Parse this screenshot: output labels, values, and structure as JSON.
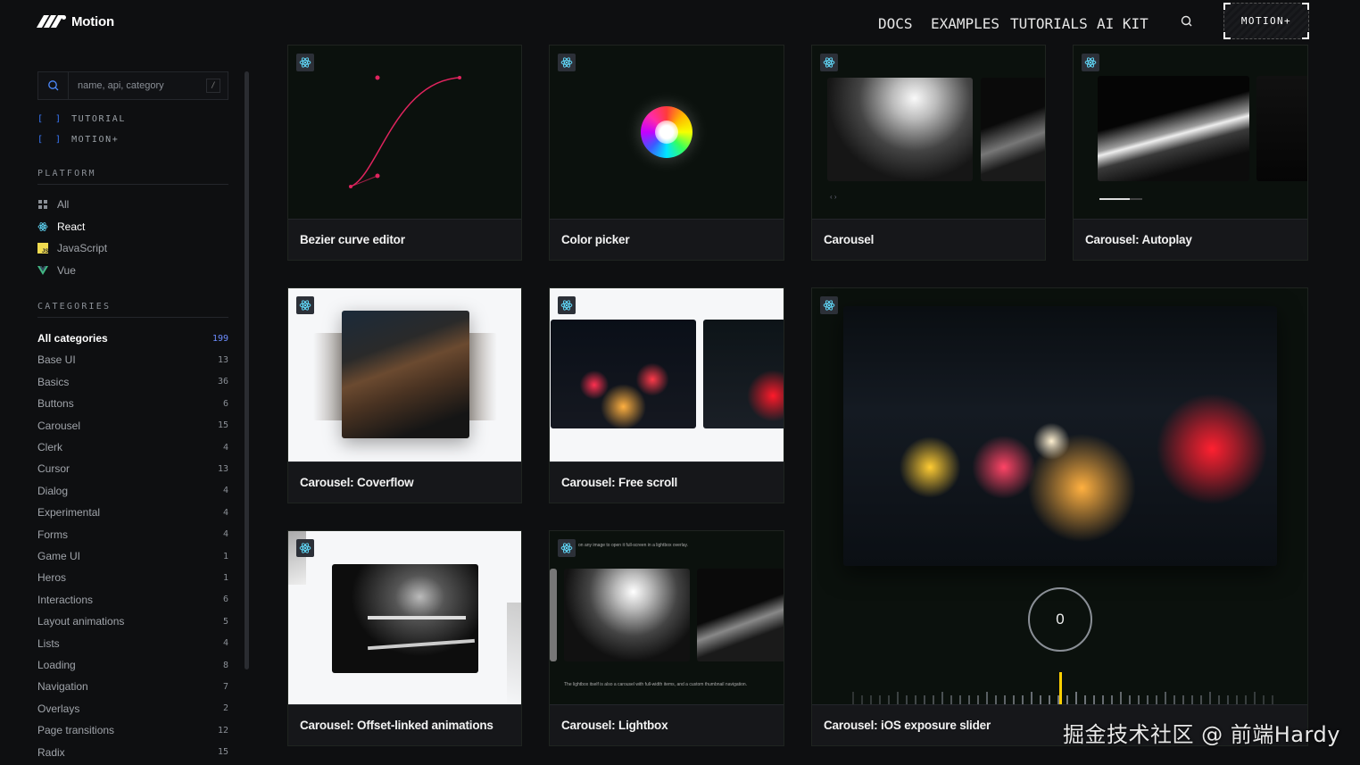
{
  "header": {
    "logo_text": "Motion",
    "nav": [
      "DOCS",
      "EXAMPLES",
      "TUTORIALS",
      "AI KIT"
    ],
    "cta_label": "MOTION+"
  },
  "sidebar": {
    "search_placeholder": "name, api, category",
    "search_shortcut": "/",
    "links": [
      {
        "bracket": "[ ]",
        "label": "TUTORIAL"
      },
      {
        "bracket": "[ ]",
        "label": "MOTION+"
      }
    ],
    "platform_title": "PLATFORM",
    "platforms": [
      {
        "label": "All",
        "icon": "grid-icon"
      },
      {
        "label": "React",
        "icon": "react-icon",
        "active": true
      },
      {
        "label": "JavaScript",
        "icon": "js-icon"
      },
      {
        "label": "Vue",
        "icon": "vue-icon"
      }
    ],
    "categories_title": "CATEGORIES",
    "categories": [
      {
        "label": "All categories",
        "count": "199",
        "active": true
      },
      {
        "label": "Base UI",
        "count": "13"
      },
      {
        "label": "Basics",
        "count": "36"
      },
      {
        "label": "Buttons",
        "count": "6"
      },
      {
        "label": "Carousel",
        "count": "15"
      },
      {
        "label": "Clerk",
        "count": "4"
      },
      {
        "label": "Cursor",
        "count": "13"
      },
      {
        "label": "Dialog",
        "count": "4"
      },
      {
        "label": "Experimental",
        "count": "4"
      },
      {
        "label": "Forms",
        "count": "4"
      },
      {
        "label": "Game UI",
        "count": "1"
      },
      {
        "label": "Heros",
        "count": "1"
      },
      {
        "label": "Interactions",
        "count": "6"
      },
      {
        "label": "Layout animations",
        "count": "5"
      },
      {
        "label": "Lists",
        "count": "4"
      },
      {
        "label": "Loading",
        "count": "8"
      },
      {
        "label": "Navigation",
        "count": "7"
      },
      {
        "label": "Overlays",
        "count": "2"
      },
      {
        "label": "Page transitions",
        "count": "12"
      },
      {
        "label": "Radix",
        "count": "15"
      }
    ]
  },
  "cards": [
    {
      "title": "Bezier curve editor"
    },
    {
      "title": "Color picker"
    },
    {
      "title": "Carousel"
    },
    {
      "title": "Carousel: Autoplay"
    },
    {
      "title": "Carousel: Coverflow"
    },
    {
      "title": "Carousel: Free scroll"
    },
    {
      "title": "Carousel: iOS exposure slider",
      "dial_value": "0"
    },
    {
      "title": "Carousel: Offset-linked animations"
    },
    {
      "title": "Carousel: Lightbox",
      "caption_top": "on any image to open it full-screen in a lightbox overlay.",
      "caption_bottom": "The lightbox itself is also a carousel with full-width items, and a custom thumbnail navigation."
    }
  ],
  "watermark": "掘金技术社区 @ 前端Hardy",
  "colors": {
    "accent_blue": "#3b7bff",
    "bezier_pink": "#e0245e",
    "react_cyan": "#61dafb"
  }
}
